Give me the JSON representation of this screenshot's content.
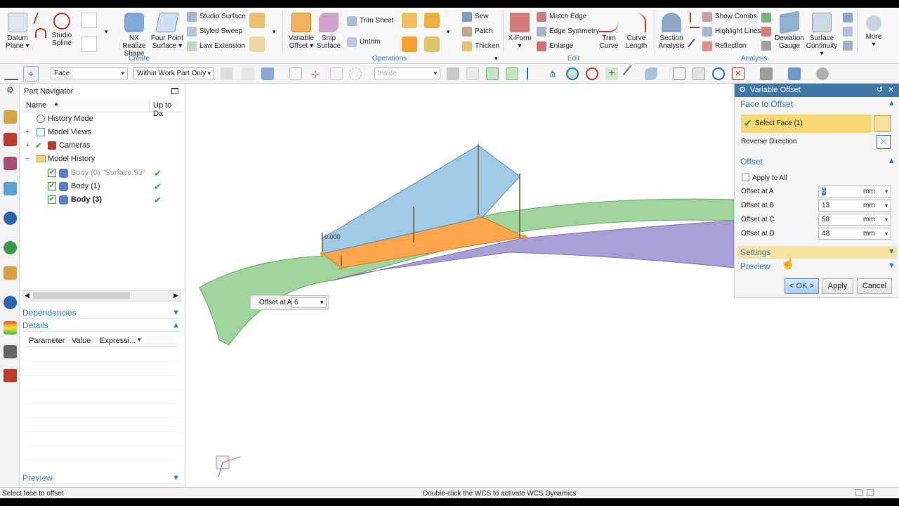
{
  "colors": {
    "accent": "#2f7bc0",
    "title_bar": "#3f78a6",
    "select_highlight": "#f7d774",
    "orange_face": "#ffa64d",
    "blue_face": "#8fc0e0",
    "green_surface": "#9fd49a",
    "purple_surface": "#a99fd6",
    "check_green": "#2fa53a"
  },
  "ribbon": {
    "buttons": {
      "datum_plane": "Datum Plane",
      "studio_spline": "Studio Spline",
      "nx_realize_shape": "NX Realize Shape",
      "four_point_surface": "Four Point Surface",
      "variable_offset": "Variable Offset",
      "snip_surface": "Snip Surface",
      "x_form": "X-Form",
      "trim_curve": "Trim Curve",
      "curve_length": "Curve Length",
      "section_analysis": "Section Analysis",
      "deviation_gauge": "Deviation Gauge",
      "surface_continuity": "Surface Continuity",
      "more": "More"
    },
    "small": {
      "studio_surface": "Studio Surface",
      "styled_sweep": "Styled Sweep",
      "law_extension": "Law Extension",
      "trim_sheet": "Trim Sheet",
      "untrim": "Untrim",
      "sew": "Sew",
      "patch": "Patch",
      "thicken": "Thicken",
      "match_edge": "Match Edge",
      "edge_symmetry": "Edge Symmetry",
      "enlarge": "Enlarge",
      "show_combs": "Show Combs",
      "highlight_lines": "Highlight Lines",
      "reflection": "Reflection"
    },
    "groups": {
      "create": "Create",
      "operations": "Operations",
      "edit": "Edit",
      "analysis": "Analysis"
    }
  },
  "toolbar": {
    "filter_type": "Face",
    "scope": "Within Work Part Only",
    "inside": "Inside"
  },
  "navigator": {
    "title": "Part Navigator",
    "col_name": "Name",
    "col_uptodate": "Up to Da",
    "items": [
      {
        "label": "History Mode"
      },
      {
        "label": "Model Views"
      },
      {
        "label": "Cameras"
      },
      {
        "label": "Model History"
      },
      {
        "label": "Body (0) \"Surface.93\""
      },
      {
        "label": "Body (1)"
      },
      {
        "label": "Body (3)"
      }
    ],
    "dependencies": "Dependencies",
    "details": "Details",
    "details_cols": [
      "Parameter",
      "Value",
      "Expressi..."
    ],
    "preview": "Preview"
  },
  "viewport": {
    "tip_label": "Offset at A",
    "tip_value": "6",
    "dim_text": "0.000"
  },
  "dialog": {
    "title": "Variable Offset",
    "face_section": "Face to Offset",
    "select_face": "Select Face (1)",
    "reverse": "Reverse Direction",
    "offset_section": "Offset",
    "apply_all": "Apply to All",
    "offsets": [
      {
        "label": "Offset at A",
        "value": "6",
        "unit": "mm"
      },
      {
        "label": "Offset at B",
        "value": "13",
        "unit": "mm"
      },
      {
        "label": "Offset at C",
        "value": "58",
        "unit": "mm"
      },
      {
        "label": "Offset at D",
        "value": "48",
        "unit": "mm"
      }
    ],
    "settings": "Settings",
    "preview": "Preview",
    "ok": "< OK >",
    "apply": "Apply",
    "cancel": "Cancel"
  },
  "status": {
    "left": "Select face to offset",
    "center": "Double-click the WCS to activate WCS Dynamics"
  }
}
